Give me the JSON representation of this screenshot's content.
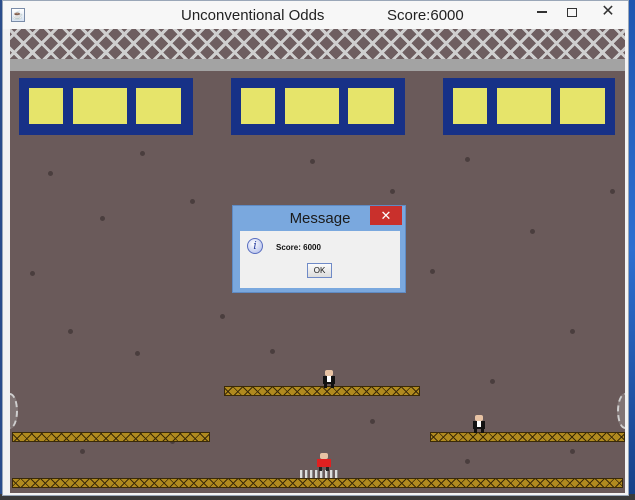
{
  "window": {
    "title": "Unconventional Odds",
    "score_label": "Score:6000",
    "app_icon_glyph": "☕",
    "close_glyph": "✕"
  },
  "dialog": {
    "title": "Message",
    "close_glyph": "✕",
    "icon_glyph": "i",
    "message": "Score: 6000",
    "ok_label": "OK"
  },
  "colors": {
    "wall": "#6a5a5a",
    "window_frame": "#173187",
    "window_pane": "#e6e46a",
    "platform": "#b08a1f",
    "player": "#e02020",
    "dialog_close": "#c9302c"
  }
}
